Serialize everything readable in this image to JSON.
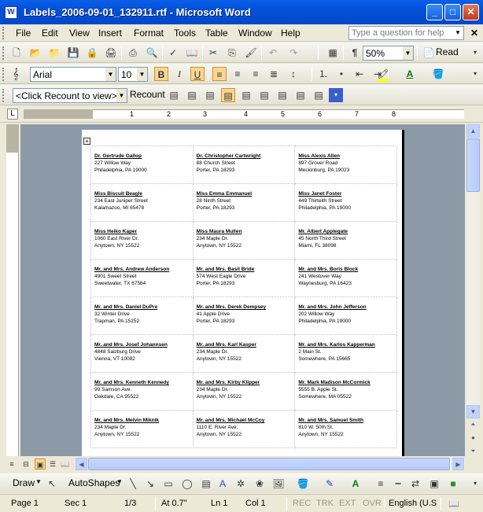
{
  "window": {
    "title": "Labels_2006-09-01_132911.rtf - Microsoft Word",
    "app_icon": "W"
  },
  "menu": {
    "items": [
      "File",
      "Edit",
      "View",
      "Insert",
      "Format",
      "Tools",
      "Table",
      "Window",
      "Help"
    ],
    "help_placeholder": "Type a question for help"
  },
  "standard_toolbar": {
    "zoom": "50%",
    "read_label": "Read"
  },
  "format_toolbar": {
    "font": "Arial",
    "size": "10",
    "bold": "B",
    "italic": "I",
    "underline": "U"
  },
  "mailmerge_toolbar": {
    "field_select": "<Click Recount to view>",
    "recount_label": "Recount"
  },
  "ruler": {
    "numbers": [
      "1",
      "2",
      "3",
      "4",
      "5",
      "6",
      "7",
      "8"
    ]
  },
  "labels": [
    [
      [
        "Dr. Gertrude Gallop",
        "227 Willow Way",
        "Philadelphia, PA 19000"
      ],
      [
        "Dr. Christopher Cartwright",
        "88 Church Street",
        "Porter, PA 18293"
      ],
      [
        "Miss Alexis Allen",
        "897 Grover Road",
        "Meckinburg, PA 19023"
      ]
    ],
    [
      [
        "Miss Biscuit Beagle",
        "234 East Juniper Street",
        "Kalamazoo, MI 65478"
      ],
      [
        "Miss Emma Emmanuel",
        "28 Ninth Street",
        "Porter, PA 18293"
      ],
      [
        "Miss Janet Foster",
        "449 Thirteith Street",
        "Philadelphia, PA 19000"
      ]
    ],
    [
      [
        "Miss Heiko Kaper",
        "1060 East River Dr.",
        "Anytown, NY 15522"
      ],
      [
        "Miss Maura Mullen",
        "234 Maple Dr.",
        "Anytown, NY 15522"
      ],
      [
        "Mr. Albert Applegate",
        "45 North Third Street",
        "Miami, FL 38098"
      ]
    ],
    [
      [
        "Mr. and Mrs. Andrew Anderson",
        "4901 Sweet Street",
        "Sweetwater, TX 67564"
      ],
      [
        "Mr. and Mrs. Basil Bride",
        "574 West Eagle Drive",
        "Porter, PA 18293"
      ],
      [
        "Mr. and Mrs. Boris Block",
        "241 Westover Way",
        "Waynesburg, PA 16423"
      ]
    ],
    [
      [
        "Mr. and Mrs. Daniel DuPre",
        "32 Winter Drive",
        "Trapman, PA 15252"
      ],
      [
        "Mr. and Mrs. Derek Dempsey",
        "41 Apple Drive",
        "Porter, PA 18293"
      ],
      [
        "Mr. and Mrs. John Jefferson",
        "202 Willow Way",
        "Philadelphia, PA 19000"
      ]
    ],
    [
      [
        "Mr. and Mrs. Josef Johannsen",
        "4848 Salzburg Drive",
        "Vienna, VT 10082"
      ],
      [
        "Mr. and Mrs. Karl Kasper",
        "234 Maple Dr.",
        "Anytown, NY 15522"
      ],
      [
        "Mr. and Mrs. Karlos Kapperman",
        "2 Main St.",
        "Somewhere, PA 15665"
      ]
    ],
    [
      [
        "Mr. and Mrs. Kenneth Kennedy",
        "99 Samson Ave.",
        "Oakdale, CA 95522"
      ],
      [
        "Mr. and Mrs. Kirby Klipper",
        "234 Maple Dr.",
        "Anytown, NY 15522"
      ],
      [
        "Mr. Mark Madison McCormick",
        "5555 B. Apple St.",
        "Somewhere, MA 05522"
      ]
    ],
    [
      [
        "Mr. and Mrs. Melvin Miknik",
        "234 Maple Dr.",
        "Anytown, NY 15522"
      ],
      [
        "Mr. and Mrs. Michael McCoy",
        "1110 E. River Ave.",
        "Anytown, NY 15522"
      ],
      [
        "Mr. and Mrs. Samuel Smith",
        "810 W. 50th St.",
        "Anytown, NY 15522"
      ]
    ]
  ],
  "drawing_toolbar": {
    "draw_label": "Draw",
    "autoshapes_label": "AutoShapes"
  },
  "status": {
    "page": "Page 1",
    "sec": "Sec 1",
    "pages": "1/3",
    "at": "At 0.7\"",
    "ln": "Ln 1",
    "col": "Col 1",
    "rec": "REC",
    "trk": "TRK",
    "ext": "EXT",
    "ovr": "OVR",
    "lang": "English (U.S"
  }
}
